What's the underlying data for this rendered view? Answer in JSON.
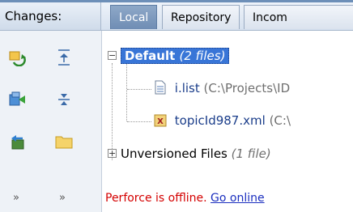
{
  "header": {
    "changes_label": "Changes:",
    "tabs": [
      {
        "label": "Local",
        "active": true
      },
      {
        "label": "Repository",
        "active": false
      },
      {
        "label": "Incom",
        "active": false
      }
    ]
  },
  "toolbar": {
    "icons": [
      "refresh-icon",
      "expand-all-icon",
      "commit-icon",
      "collapse-all-icon",
      "rollback-icon",
      "folder-icon"
    ],
    "overflow": [
      "»",
      "»"
    ]
  },
  "tree": {
    "default_list": {
      "name": "Default",
      "count": "(2 files)"
    },
    "files": [
      {
        "name": "i.list",
        "path": "(C:\\Projects\\ID"
      },
      {
        "name": "topicId987.xml",
        "path": "(C:\\"
      }
    ],
    "unversioned": {
      "name": "Unversioned Files",
      "count": "(1 file)"
    }
  },
  "status": {
    "offline_text": "Perforce is offline.",
    "link_text": "Go online"
  },
  "colors": {
    "selection": "#3875d7",
    "offline": "#d40000",
    "link": "#1b2fbf"
  }
}
